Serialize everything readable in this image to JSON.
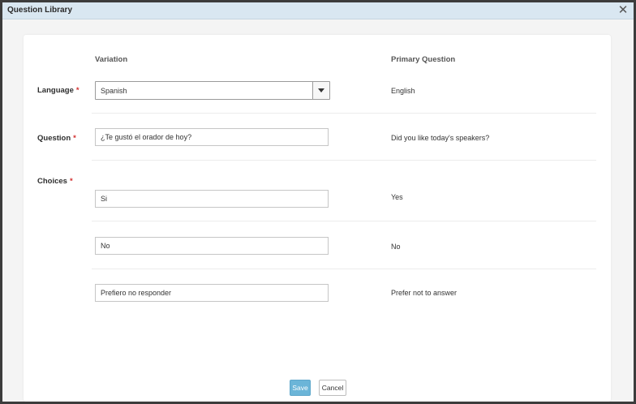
{
  "dialog": {
    "title": "Question Library",
    "close_icon": "close-icon"
  },
  "columns": {
    "variation": "Variation",
    "primary": "Primary Question"
  },
  "form": {
    "language": {
      "label": "Language",
      "required_mark": "*",
      "value": "Spanish",
      "primary": "English"
    },
    "question": {
      "label": "Question",
      "required_mark": "*",
      "value": "¿Te gustó el orador de hoy?",
      "primary": "Did you like today's speakers?"
    },
    "choices": {
      "label": "Choices",
      "required_mark": "*",
      "items": [
        {
          "value": "Si",
          "primary": "Yes"
        },
        {
          "value": "No",
          "primary": "No"
        },
        {
          "value": "Prefiero no responder",
          "primary": "Prefer not to answer"
        }
      ]
    }
  },
  "buttons": {
    "save": "Save",
    "cancel": "Cancel"
  },
  "colors": {
    "titlebar": "#d9e7f1",
    "save_button": "#6bb5d8",
    "required": "#d32f2f"
  }
}
